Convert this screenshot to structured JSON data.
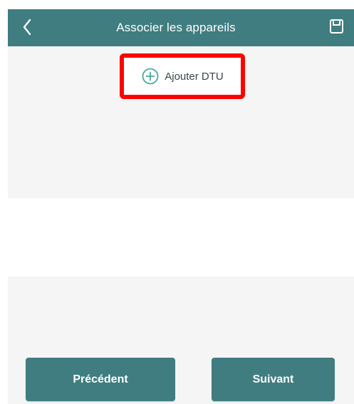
{
  "header": {
    "title": "Associer les appareils",
    "back_icon": "chevron-left-icon",
    "save_icon": "save-icon"
  },
  "main": {
    "add_dtu_label": "Ajouter DTU",
    "add_icon": "plus-circle-icon"
  },
  "footer": {
    "previous_label": "Précédent",
    "next_label": "Suivant"
  },
  "colors": {
    "brand": "#3f7d80",
    "panel_background": "#f5f5f5",
    "highlight_border": "#ff0000",
    "add_icon": "#4aa8a2"
  }
}
